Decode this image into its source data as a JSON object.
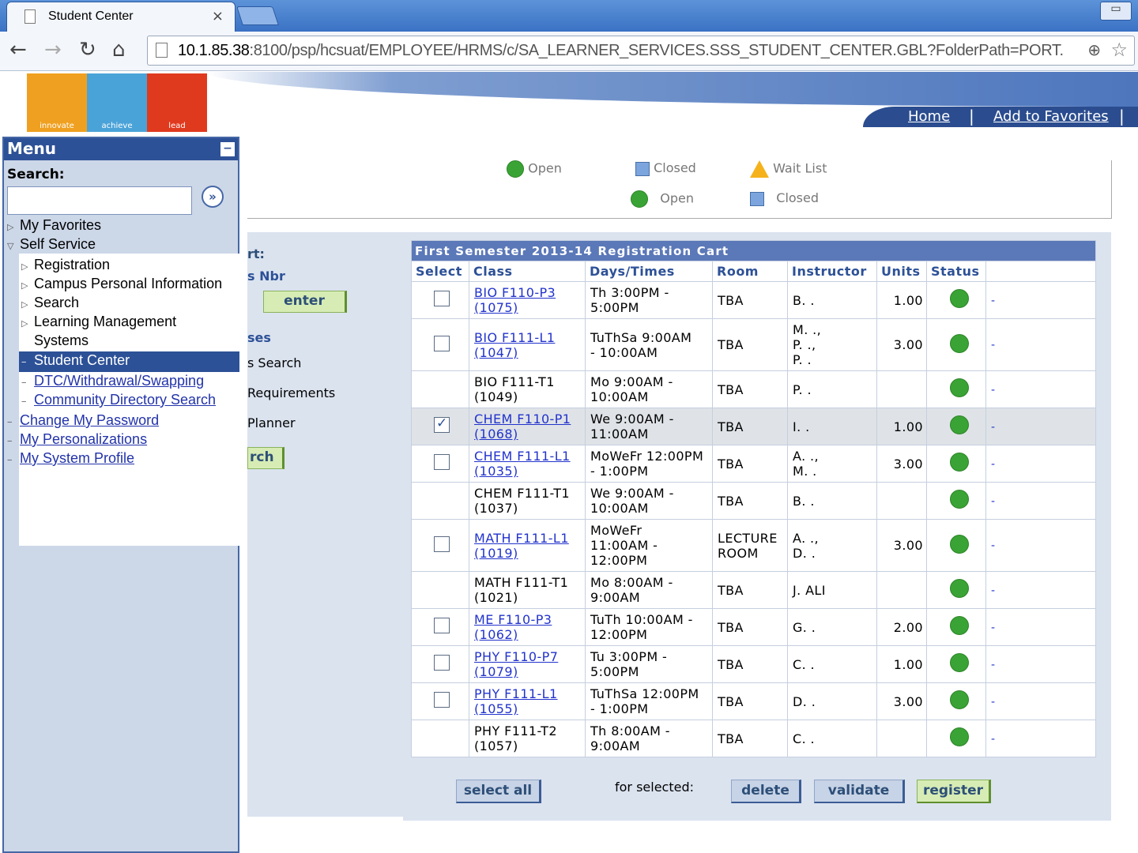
{
  "browser": {
    "tab_title": "Student Center",
    "tab_close": "×",
    "minimize": "▭",
    "url_host": "10.1.85.38",
    "url_rest": ":8100/psp/hcsuat/EMPLOYEE/HRMS/c/SA_LEARNER_SERVICES.SSS_STUDENT_CENTER.GBL?FolderPath=PORT."
  },
  "logo": {
    "words": [
      "innovate",
      "achieve",
      "lead"
    ],
    "colors": [
      "#f0a020",
      "#4aa3d8",
      "#e03a1e"
    ]
  },
  "header_nav": {
    "home": "Home",
    "favorites": "Add to Favorites"
  },
  "menu": {
    "title": "Menu",
    "search_label": "Search:",
    "items": {
      "my_favorites": "My Favorites",
      "self_service": "Self Service",
      "registration": "Registration",
      "campus_personal": "Campus Personal Information",
      "search": "Search",
      "learning_mgmt_1": "Learning Management",
      "learning_mgmt_2": "Systems",
      "student_center": "Student Center",
      "dtc": "DTC/Withdrawal/Swapping",
      "community": "Community Directory Search",
      "change_pw": "Change My Password",
      "personalizations": "My Personalizations",
      "system_profile": "My System Profile"
    }
  },
  "legend": {
    "open1": "Open",
    "closed1": "Closed",
    "waitlist": "Wait List",
    "open2": "Open",
    "closed2": "Closed"
  },
  "left_panel": {
    "start": "rt:",
    "class_nbr": "s Nbr",
    "enter_btn": "enter",
    "classes": "ses",
    "search": "s Search",
    "requirements": "Requirements",
    "planner": "Planner",
    "search_btn": "rch"
  },
  "cart": {
    "title": "First Semester 2013-14 Registration Cart",
    "headers": [
      "Select",
      "Class",
      "Days/Times",
      "Room",
      "Instructor",
      "Units",
      "Status"
    ],
    "rows": [
      {
        "select": "box",
        "class_1": "BIO F110-P3",
        "class_2": "(1075)",
        "link": true,
        "days_1": "Th 3:00PM -",
        "days_2": "5:00PM",
        "days_3": "",
        "room_1": "TBA",
        "room_2": "",
        "instr_1": "B. .",
        "instr_2": "",
        "instr_3": "",
        "units": "1.00",
        "sel": false
      },
      {
        "select": "box",
        "class_1": "BIO F111-L1",
        "class_2": "(1047)",
        "link": true,
        "days_1": "TuThSa 9:00AM",
        "days_2": "- 10:00AM",
        "days_3": "",
        "room_1": "TBA",
        "room_2": "",
        "instr_1": "M. .,",
        "instr_2": "P. .,",
        "instr_3": "P. .",
        "units": "3.00",
        "sel": false
      },
      {
        "select": "none",
        "class_1": "BIO F111-T1",
        "class_2": "(1049)",
        "link": false,
        "days_1": "Mo 9:00AM -",
        "days_2": "10:00AM",
        "days_3": "",
        "room_1": "TBA",
        "room_2": "",
        "instr_1": "P. .",
        "instr_2": "",
        "instr_3": "",
        "units": "",
        "sel": false
      },
      {
        "select": "checked",
        "class_1": "CHEM F110-P1",
        "class_2": "(1068)",
        "link": true,
        "days_1": "We 9:00AM -",
        "days_2": "11:00AM",
        "days_3": "",
        "room_1": "TBA",
        "room_2": "",
        "instr_1": "I. .",
        "instr_2": "",
        "instr_3": "",
        "units": "1.00",
        "sel": true
      },
      {
        "select": "box",
        "class_1": "CHEM F111-L1",
        "class_2": "(1035)",
        "link": true,
        "days_1": "MoWeFr 12:00PM",
        "days_2": "- 1:00PM",
        "days_3": "",
        "room_1": "TBA",
        "room_2": "",
        "instr_1": "A. .,",
        "instr_2": "M. .",
        "instr_3": "",
        "units": "3.00",
        "sel": false
      },
      {
        "select": "none",
        "class_1": "CHEM F111-T1",
        "class_2": "(1037)",
        "link": false,
        "days_1": "We 9:00AM -",
        "days_2": "10:00AM",
        "days_3": "",
        "room_1": "TBA",
        "room_2": "",
        "instr_1": "B. .",
        "instr_2": "",
        "instr_3": "",
        "units": "",
        "sel": false
      },
      {
        "select": "box",
        "class_1": "MATH F111-L1",
        "class_2": "(1019)",
        "link": true,
        "days_1": "MoWeFr",
        "days_2": "11:00AM -",
        "days_3": "12:00PM",
        "room_1": "LECTURE",
        "room_2": "ROOM",
        "instr_1": "A. .,",
        "instr_2": "D. .",
        "instr_3": "",
        "units": "3.00",
        "sel": false
      },
      {
        "select": "none",
        "class_1": "MATH F111-T1",
        "class_2": "(1021)",
        "link": false,
        "days_1": "Mo 8:00AM -",
        "days_2": "9:00AM",
        "days_3": "",
        "room_1": "TBA",
        "room_2": "",
        "instr_1": "J. ALI",
        "instr_2": "",
        "instr_3": "",
        "units": "",
        "sel": false
      },
      {
        "select": "box",
        "class_1": "ME F110-P3",
        "class_2": "(1062)",
        "link": true,
        "days_1": "TuTh 10:00AM -",
        "days_2": "12:00PM",
        "days_3": "",
        "room_1": "TBA",
        "room_2": "",
        "instr_1": "G. .",
        "instr_2": "",
        "instr_3": "",
        "units": "2.00",
        "sel": false
      },
      {
        "select": "box",
        "class_1": "PHY F110-P7",
        "class_2": "(1079)",
        "link": true,
        "days_1": "Tu 3:00PM -",
        "days_2": "5:00PM",
        "days_3": "",
        "room_1": "TBA",
        "room_2": "",
        "instr_1": "C. .",
        "instr_2": "",
        "instr_3": "",
        "units": "1.00",
        "sel": false
      },
      {
        "select": "box",
        "class_1": "PHY F111-L1",
        "class_2": "(1055)",
        "link": true,
        "days_1": "TuThSa 12:00PM",
        "days_2": "- 1:00PM",
        "days_3": "",
        "room_1": "TBA",
        "room_2": "",
        "instr_1": "D. .",
        "instr_2": "",
        "instr_3": "",
        "units": "3.00",
        "sel": false
      },
      {
        "select": "none",
        "class_1": "PHY F111-T2",
        "class_2": "(1057)",
        "link": false,
        "days_1": "Th 8:00AM -",
        "days_2": "9:00AM",
        "days_3": "",
        "room_1": "TBA",
        "room_2": "",
        "instr_1": "C. .",
        "instr_2": "",
        "instr_3": "",
        "units": "",
        "sel": false
      }
    ],
    "status_dash": "-",
    "buttons": {
      "select_all": "select all",
      "for_selected": "for selected:",
      "delete": "delete",
      "validate": "validate",
      "register": "register"
    }
  },
  "colors": {
    "status_open": "#3aa335",
    "menu_header": "#2d5197",
    "status_closed": "#7ca5dd",
    "waitlist": "#f5b21b"
  }
}
